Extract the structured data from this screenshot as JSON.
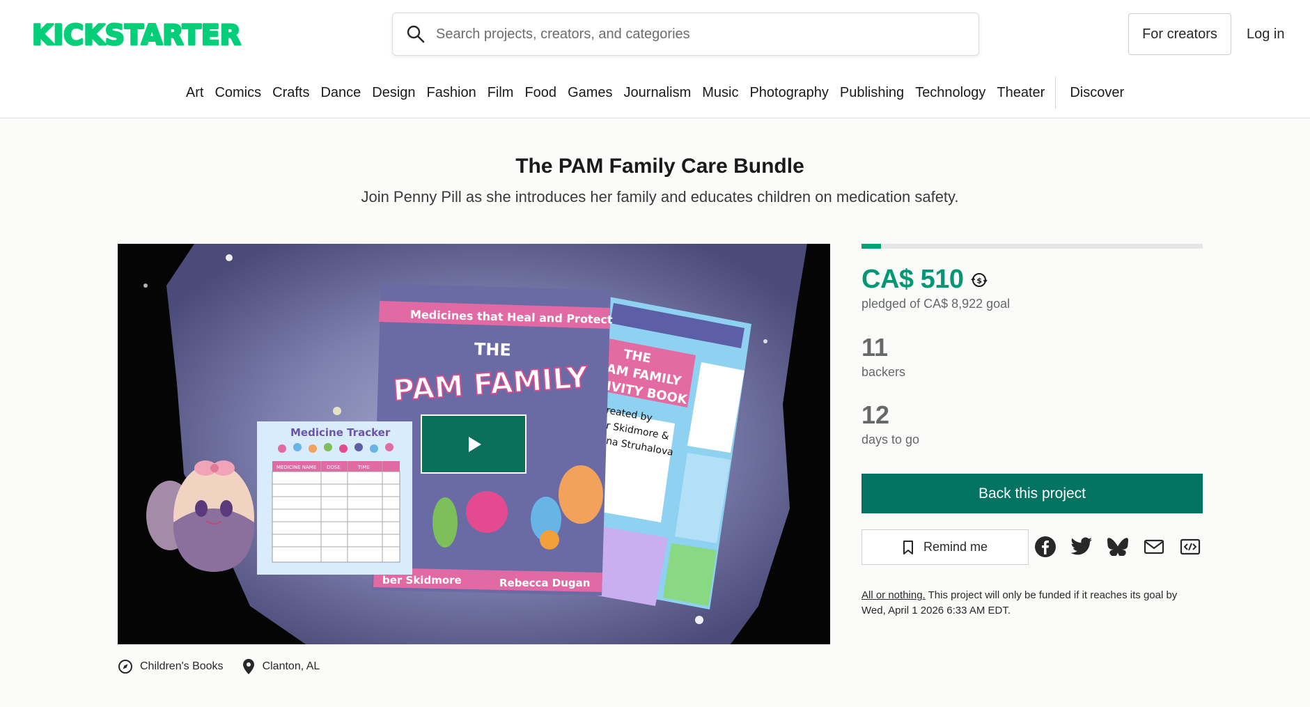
{
  "header": {
    "logo_text": "KICKSTARTER",
    "search_placeholder": "Search projects, creators, and categories",
    "for_creators": "For creators",
    "login": "Log in"
  },
  "categories": [
    "Art",
    "Comics",
    "Crafts",
    "Dance",
    "Design",
    "Fashion",
    "Film",
    "Food",
    "Games",
    "Journalism",
    "Music",
    "Photography",
    "Publishing",
    "Technology",
    "Theater"
  ],
  "discover": "Discover",
  "project": {
    "title": "The PAM Family Care Bundle",
    "subtitle": "Join Penny Pill as she introduces her family and educates children on medication safety.",
    "video": {
      "book_banner": "Medicines that Heal and Protect",
      "book_title_the": "THE",
      "book_title_main": "PAM FAMILY",
      "book_authors_left": "ber Skidmore",
      "book_authors_right": "Rebecca Dugan",
      "activity_title_1": "THE",
      "activity_title_2": "AM FAMILY",
      "activity_title_3": "IVITY BOOK",
      "activity_credit_1": "reated by",
      "activity_credit_2": "r Skidmore &",
      "activity_credit_3": "na Struhalova",
      "tracker_title": "Medicine Tracker",
      "tracker_cols": [
        "MEDICINE NAME",
        "DOSE",
        "TIME"
      ]
    },
    "category": "Children's Books",
    "location": "Clanton, AL"
  },
  "funding": {
    "progress": 0.057,
    "pledged": "CA$ 510",
    "goal_text": "pledged of CA$ 8,922 goal",
    "backers": "11",
    "backers_label": "backers",
    "days": "12",
    "days_label": "days to go",
    "back_button": "Back this project",
    "remind_button": "Remind me",
    "aon_link": "All or nothing.",
    "aon_text": " This project will only be funded if it reaches its goal by Wed, April 1 2026 6:33 AM EDT."
  },
  "share_icons": [
    "facebook-icon",
    "twitter-icon",
    "bluesky-icon",
    "email-icon",
    "embed-icon"
  ],
  "colors": {
    "brand_green": "#05ce78",
    "pledged_green": "#039875",
    "back_button": "#037362",
    "progress_fill": "#05a374"
  }
}
